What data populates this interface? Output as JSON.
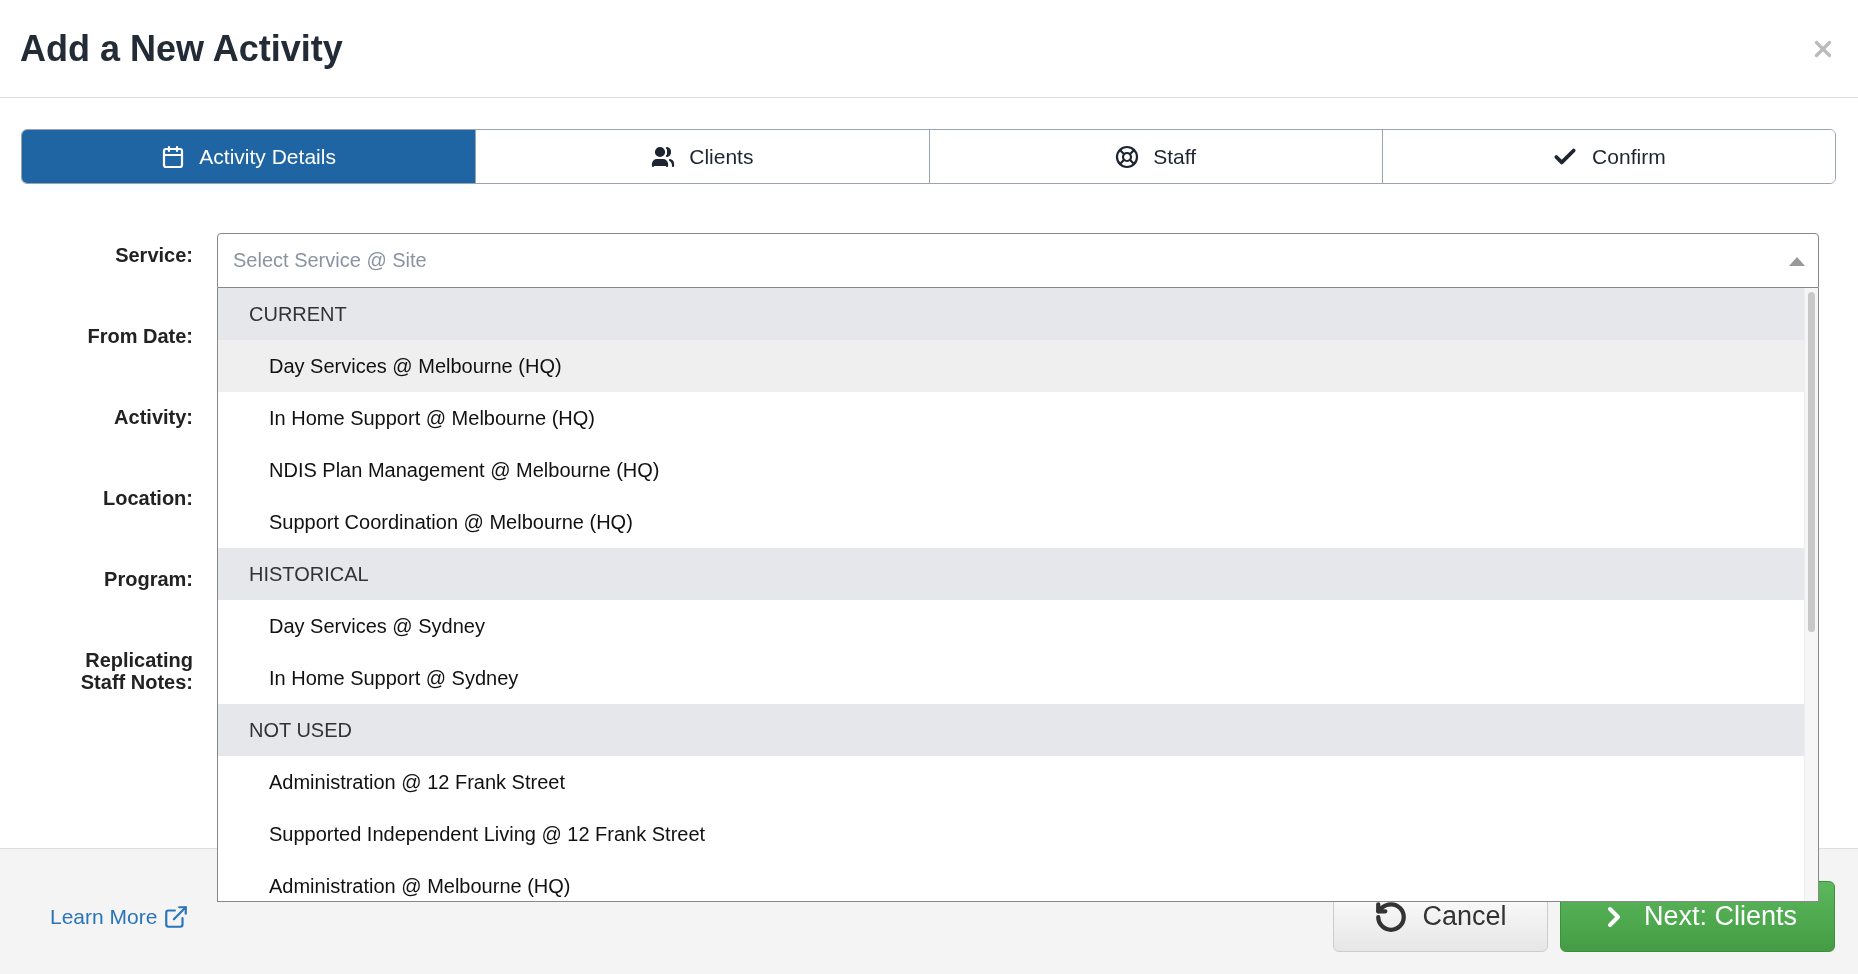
{
  "dialog": {
    "title": "Add a New Activity"
  },
  "tabs": [
    {
      "label": "Activity Details",
      "selected": true
    },
    {
      "label": "Clients",
      "selected": false
    },
    {
      "label": "Staff",
      "selected": false
    },
    {
      "label": "Confirm",
      "selected": false
    }
  ],
  "form": {
    "labels": [
      "Service:",
      "From Date:",
      "Activity:",
      "Location:",
      "Program:",
      "Replicating Staff Notes:"
    ],
    "service": {
      "placeholder": "Select Service @ Site",
      "expanded": true
    },
    "menu": [
      {
        "heading": "CURRENT",
        "items": [
          {
            "label": "Day Services @ Melbourne (HQ)",
            "highlighted": true
          },
          {
            "label": "In Home Support @ Melbourne (HQ)",
            "highlighted": false
          },
          {
            "label": "NDIS Plan Management @ Melbourne (HQ)",
            "highlighted": false
          },
          {
            "label": "Support Coordination @ Melbourne (HQ)",
            "highlighted": false
          }
        ]
      },
      {
        "heading": "HISTORICAL",
        "items": [
          {
            "label": "Day Services @ Sydney",
            "highlighted": false
          },
          {
            "label": "In Home Support @ Sydney",
            "highlighted": false
          }
        ]
      },
      {
        "heading": "NOT USED",
        "items": [
          {
            "label": "Administration @ 12 Frank Street",
            "highlighted": false
          },
          {
            "label": "Supported Independent Living @ 12 Frank Street",
            "highlighted": false
          },
          {
            "label": "Administration @ Melbourne (HQ)",
            "highlighted": false
          }
        ]
      }
    ]
  },
  "footer": {
    "link": "Learn More",
    "buttons": [
      {
        "kind": "cancel",
        "label": "Cancel"
      },
      {
        "kind": "next",
        "label": "Next: Clients"
      }
    ]
  }
}
